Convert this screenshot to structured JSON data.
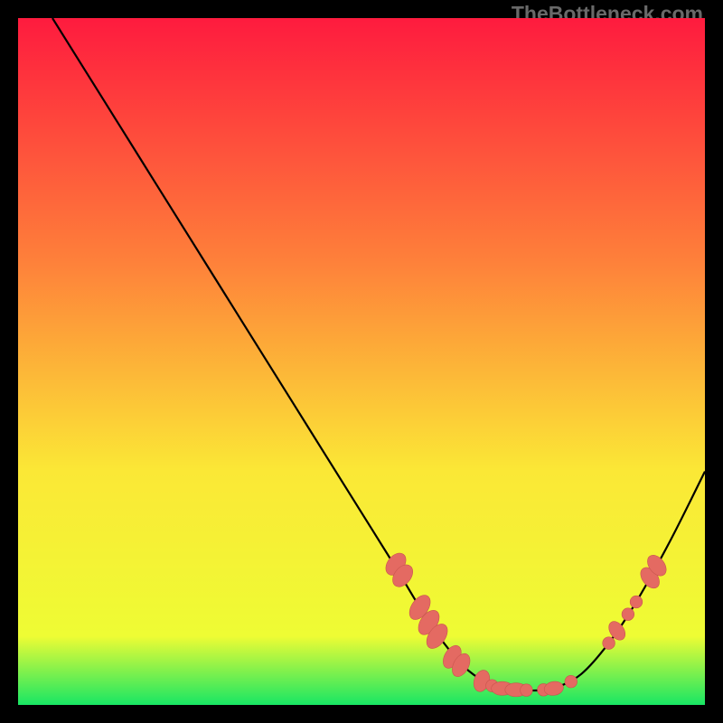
{
  "watermark": "TheBottleneck.com",
  "colors": {
    "gradient_top": "#fe1b3e",
    "gradient_mid1": "#fe7f3a",
    "gradient_mid2": "#fbe836",
    "gradient_mid3": "#eefc34",
    "gradient_bottom": "#18e664",
    "curve": "#000000",
    "marker_fill": "#e46a62",
    "marker_stroke": "#c9554e",
    "frame": "#000000"
  },
  "chart_data": {
    "type": "line",
    "title": "",
    "xlabel": "",
    "ylabel": "",
    "xlim": [
      0,
      100
    ],
    "ylim": [
      0,
      100
    ],
    "curve": {
      "x": [
        5,
        10,
        15,
        20,
        25,
        30,
        35,
        40,
        45,
        50,
        55,
        58,
        60,
        62,
        65,
        68,
        70,
        72,
        75,
        78,
        82,
        86,
        90,
        95,
        100
      ],
      "y": [
        100,
        92,
        84,
        76,
        68,
        60,
        52,
        44,
        36,
        28,
        20,
        15,
        12,
        9,
        5.5,
        3.3,
        2.5,
        2.2,
        2.1,
        2.4,
        4.5,
        9,
        15,
        24,
        34
      ]
    },
    "markers": [
      {
        "x": 55.0,
        "y": 20.5,
        "shape": "ellipse",
        "rx": 1.2,
        "ry": 1.8,
        "rot": 38
      },
      {
        "x": 56.0,
        "y": 18.8,
        "shape": "ellipse",
        "rx": 1.2,
        "ry": 1.8,
        "rot": 38
      },
      {
        "x": 58.5,
        "y": 14.2,
        "shape": "ellipse",
        "rx": 1.2,
        "ry": 2.0,
        "rot": 35
      },
      {
        "x": 59.8,
        "y": 12.0,
        "shape": "ellipse",
        "rx": 1.2,
        "ry": 2.0,
        "rot": 35
      },
      {
        "x": 61.0,
        "y": 10.0,
        "shape": "ellipse",
        "rx": 1.2,
        "ry": 2.0,
        "rot": 35
      },
      {
        "x": 63.2,
        "y": 7.0,
        "shape": "ellipse",
        "rx": 1.1,
        "ry": 1.8,
        "rot": 30
      },
      {
        "x": 64.5,
        "y": 5.8,
        "shape": "ellipse",
        "rx": 1.1,
        "ry": 1.8,
        "rot": 28
      },
      {
        "x": 67.5,
        "y": 3.5,
        "shape": "ellipse",
        "rx": 1.1,
        "ry": 1.6,
        "rot": 18
      },
      {
        "x": 69.0,
        "y": 2.8,
        "shape": "circle",
        "r": 0.9
      },
      {
        "x": 70.5,
        "y": 2.4,
        "shape": "ellipse",
        "rx": 1.6,
        "ry": 1.0,
        "rot": 0
      },
      {
        "x": 72.5,
        "y": 2.2,
        "shape": "ellipse",
        "rx": 1.6,
        "ry": 1.0,
        "rot": 0
      },
      {
        "x": 74.0,
        "y": 2.15,
        "shape": "circle",
        "r": 0.9
      },
      {
        "x": 76.5,
        "y": 2.2,
        "shape": "circle",
        "r": 0.9
      },
      {
        "x": 78.0,
        "y": 2.4,
        "shape": "ellipse",
        "rx": 1.4,
        "ry": 1.0,
        "rot": -10
      },
      {
        "x": 80.5,
        "y": 3.4,
        "shape": "circle",
        "r": 0.9
      },
      {
        "x": 86.0,
        "y": 9.0,
        "shape": "circle",
        "r": 0.9
      },
      {
        "x": 87.2,
        "y": 10.8,
        "shape": "ellipse",
        "rx": 1.0,
        "ry": 1.5,
        "rot": -35
      },
      {
        "x": 88.8,
        "y": 13.2,
        "shape": "circle",
        "r": 0.9
      },
      {
        "x": 90.0,
        "y": 15.0,
        "shape": "circle",
        "r": 0.9
      },
      {
        "x": 92.0,
        "y": 18.5,
        "shape": "ellipse",
        "rx": 1.1,
        "ry": 1.7,
        "rot": -38
      },
      {
        "x": 93.0,
        "y": 20.3,
        "shape": "ellipse",
        "rx": 1.1,
        "ry": 1.7,
        "rot": -38
      }
    ]
  }
}
